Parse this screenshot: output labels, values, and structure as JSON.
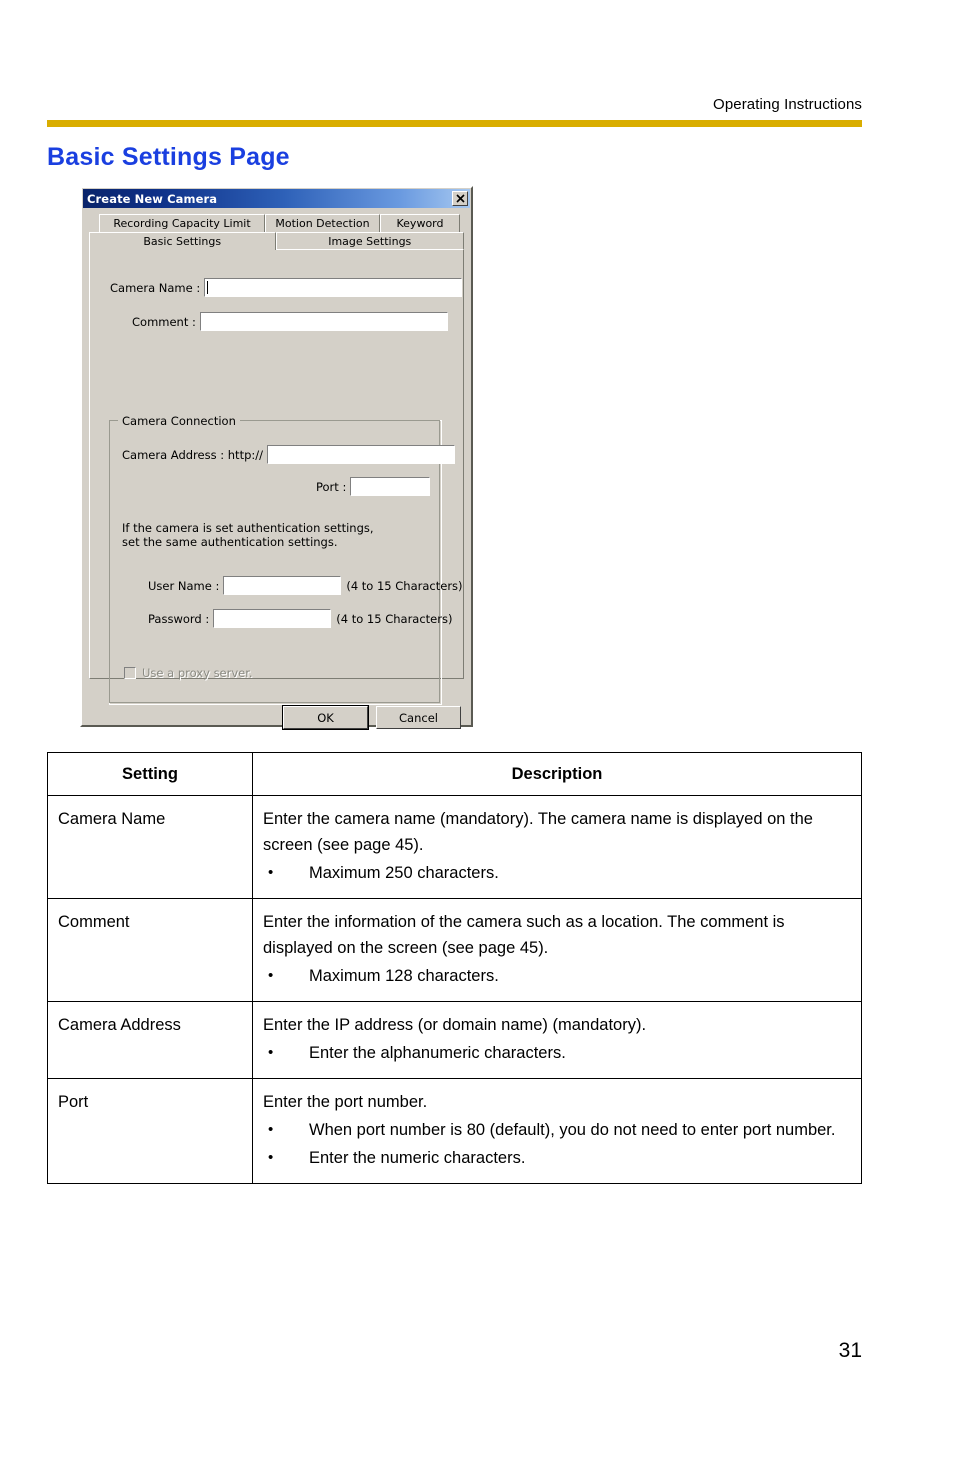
{
  "header": {
    "running_head": "Operating Instructions",
    "rule_color": "#d9ad00"
  },
  "section": {
    "heading": "Basic Settings Page",
    "heading_color": "#1a3fe0"
  },
  "dialog": {
    "title": "Create New Camera",
    "close_icon": "✕",
    "tabs_row1": [
      {
        "label": "Recording Capacity Limit",
        "selected": false
      },
      {
        "label": "Motion Detection",
        "selected": false
      },
      {
        "label": "Keyword",
        "selected": false
      }
    ],
    "tabs_row2": [
      {
        "label": "Basic Settings",
        "selected": true
      },
      {
        "label": "Image Settings",
        "selected": false
      }
    ],
    "fields": {
      "camera_name_label": "Camera Name :",
      "camera_name_value": "",
      "comment_label": "Comment :",
      "comment_value": ""
    },
    "group": {
      "title": "Camera Connection",
      "camera_address_label": "Camera Address : http://",
      "camera_address_value": "",
      "port_label": "Port :",
      "port_value": "",
      "auth_note_line1": "If the camera is set authentication settings,",
      "auth_note_line2": "set the same authentication settings.",
      "user_name_label": "User Name :",
      "user_name_value": "",
      "user_name_hint": "(4 to 15 Characters)",
      "password_label": "Password :",
      "password_value": "",
      "password_hint": "(4 to 15 Characters)",
      "proxy_checkbox_label": "Use a proxy server.",
      "proxy_checked": false,
      "proxy_disabled": true
    },
    "buttons": {
      "ok": "OK",
      "cancel": "Cancel"
    }
  },
  "table": {
    "headers": {
      "setting": "Setting",
      "description": "Description"
    },
    "rows": [
      {
        "setting": "Camera Name",
        "description": "Enter the camera name (mandatory). The camera name is displayed on the screen (see page 45).",
        "bullets": [
          "Maximum 250 characters."
        ]
      },
      {
        "setting": "Comment",
        "description": "Enter the information of the camera such as a location. The comment is displayed on the screen (see page 45).",
        "bullets": [
          "Maximum 128 characters."
        ]
      },
      {
        "setting": "Camera Address",
        "description": "Enter the IP address (or domain name) (mandatory).",
        "bullets": [
          "Enter the alphanumeric characters."
        ]
      },
      {
        "setting": "Port",
        "description": "Enter the port number.",
        "bullets": [
          "When port number is 80 (default), you do not need to enter port number.",
          "Enter the numeric characters."
        ]
      }
    ]
  },
  "footer": {
    "page_number": "31"
  }
}
